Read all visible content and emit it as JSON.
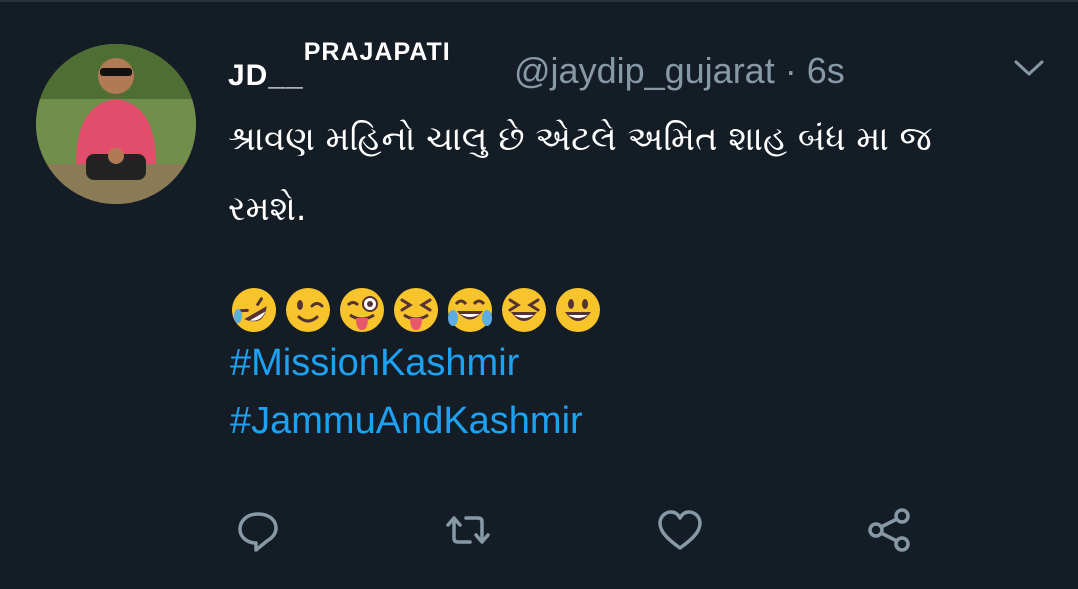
{
  "tweet": {
    "display_name": "JD__",
    "display_name_sup": "PRAJAPATI",
    "handle": "@jaydip_gujarat",
    "separator": "·",
    "time": "6s",
    "text_line1": "શ્રાવણ મહિનો ચાલુ છે એટલે અમિત શાહ બંધ મા જ",
    "text_line2": "રમશે.",
    "emojis": [
      "rolling-on-floor-laughing",
      "winking-face",
      "winking-tongue-face",
      "squinting-tongue-face",
      "tears-of-joy",
      "grinning-squinting-face",
      "grinning-face"
    ],
    "hashtags": [
      "#MissionKashmir",
      "#JammuAndKashmir"
    ]
  },
  "actions": [
    "reply-icon",
    "retweet-icon",
    "like-icon",
    "share-icon"
  ],
  "colors": {
    "background": "#141d26",
    "text": "#ffffff",
    "muted": "#8899a6",
    "link": "#1da1f2",
    "emoji": "#f7c52b"
  }
}
